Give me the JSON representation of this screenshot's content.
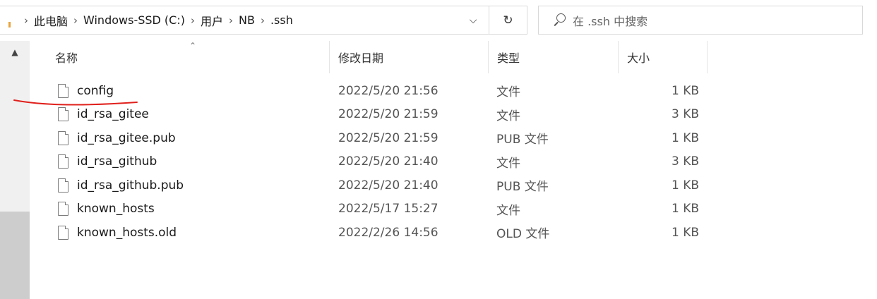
{
  "breadcrumb": {
    "items": [
      "此电脑",
      "Windows-SSD (C:)",
      "用户",
      "NB",
      ".ssh"
    ]
  },
  "search": {
    "placeholder": "在 .ssh 中搜索"
  },
  "columns": {
    "name": "名称",
    "date": "修改日期",
    "type": "类型",
    "size": "大小"
  },
  "files": [
    {
      "name": "config",
      "date": "2022/5/20 21:56",
      "type": "文件",
      "size": "1 KB"
    },
    {
      "name": "id_rsa_gitee",
      "date": "2022/5/20 21:59",
      "type": "文件",
      "size": "3 KB"
    },
    {
      "name": "id_rsa_gitee.pub",
      "date": "2022/5/20 21:59",
      "type": "PUB 文件",
      "size": "1 KB"
    },
    {
      "name": "id_rsa_github",
      "date": "2022/5/20 21:40",
      "type": "文件",
      "size": "3 KB"
    },
    {
      "name": "id_rsa_github.pub",
      "date": "2022/5/20 21:40",
      "type": "PUB 文件",
      "size": "1 KB"
    },
    {
      "name": "known_hosts",
      "date": "2022/5/17 15:27",
      "type": "文件",
      "size": "1 KB"
    },
    {
      "name": "known_hosts.old",
      "date": "2022/2/26 14:56",
      "type": "OLD 文件",
      "size": "1 KB"
    }
  ],
  "icons": {
    "refresh": "refresh-icon",
    "search": "search-icon",
    "dropdown": "chevron-down-icon",
    "file": "file-icon",
    "scroll_up": "scroll-up-arrow-icon"
  },
  "colors": {
    "annotation": "#e0201c"
  }
}
